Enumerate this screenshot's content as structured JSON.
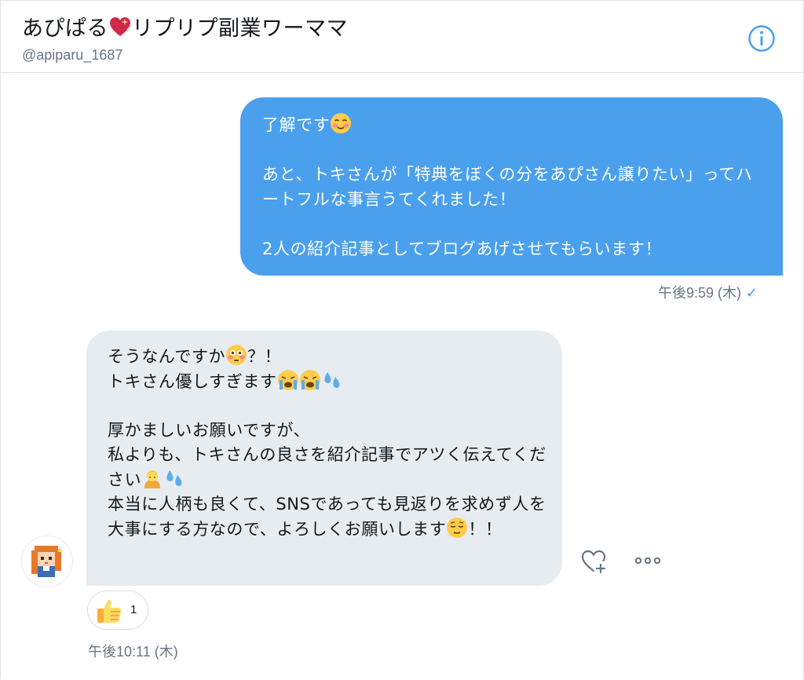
{
  "header": {
    "name_prefix": "あぴぱる",
    "name_suffix": "リプリプ副業ワーママ",
    "heart_icon": "sparkling-heart-icon",
    "handle": "@apiparu_1687",
    "info_icon": "info-icon"
  },
  "colors": {
    "accent": "#4aa0ec",
    "bubble_in": "#e6ecf0",
    "muted_text": "#657786",
    "divider": "#d5dce3"
  },
  "sent_message": {
    "line1": "了解です",
    "line1_emoji": "smiling-face-icon",
    "paragraph2": "あと、トキさんが「特典をぼくの分をあぴさん譲りたい」ってハートフルな事言うてくれました！",
    "paragraph3": "2人の紹介記事としてブログあげさせてもらいます！",
    "timestamp": "午後9:59 (木)",
    "read_icon": "checkmark-icon"
  },
  "received_message": {
    "line1": "そうなんですか",
    "line1_emoji": "flushed-face-icon",
    "line1_end": "？！",
    "line2": "トキさん優しすぎます",
    "line2_emojis": [
      "crying-face-icon",
      "crying-face-icon",
      "sweat-droplets-icon"
    ],
    "paragraph2_line1": "厚かましいお願いですが、",
    "paragraph2_line2": "私よりも、トキさんの良さを紹介記事でアツく伝えてください",
    "paragraph2_line2_emojis": [
      "person-bowing-icon",
      "sweat-droplets-icon"
    ],
    "paragraph2_line3": "本当に人柄も良くて、SNSであっても見返りを求めず人を大事にする方なので、よろしくお願いします",
    "paragraph2_line3_emoji": "relieved-face-icon",
    "paragraph2_line3_end": "！！",
    "avatar_icon": "pixel-art-avatar-icon",
    "reaction_icon": "thumbs-up-icon",
    "reaction_count": "1",
    "timestamp": "午後10:11 (木)"
  },
  "actions": {
    "like_icon": "heart-plus-icon",
    "more_icon": "more-dots-icon"
  }
}
